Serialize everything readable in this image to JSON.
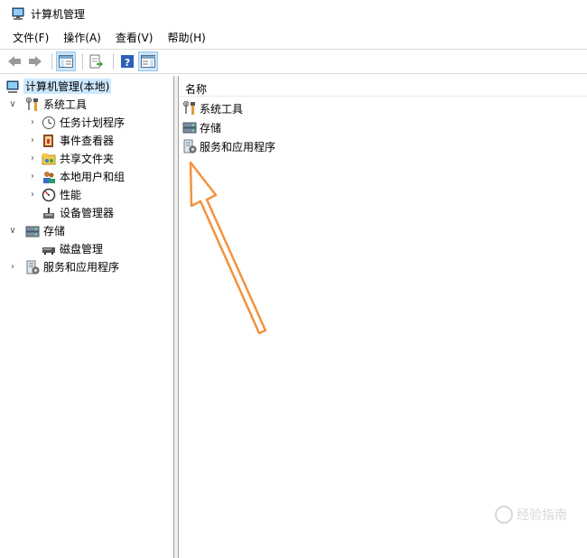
{
  "window": {
    "title": "计算机管理"
  },
  "menubar": [
    "文件(F)",
    "操作(A)",
    "查看(V)",
    "帮助(H)"
  ],
  "tree": {
    "root": "计算机管理(本地)",
    "system_tools": "系统工具",
    "task_scheduler": "任务计划程序",
    "event_viewer": "事件查看器",
    "shared_folders": "共享文件夹",
    "local_users": "本地用户和组",
    "performance": "性能",
    "device_manager": "设备管理器",
    "storage": "存储",
    "disk_management": "磁盘管理",
    "services_apps": "服务和应用程序"
  },
  "content": {
    "column_header": "名称",
    "items": [
      "系统工具",
      "存储",
      "服务和应用程序"
    ]
  },
  "watermark": "经验指南",
  "annotation": {
    "arrow_color": "#f5923e"
  }
}
